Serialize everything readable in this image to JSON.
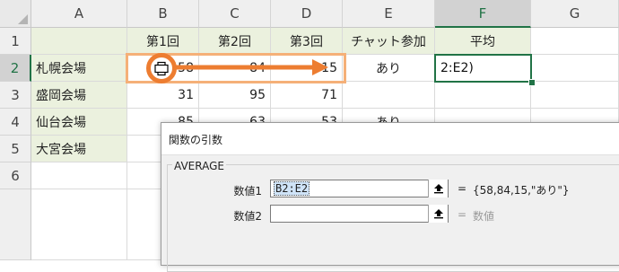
{
  "columns": [
    "A",
    "B",
    "C",
    "D",
    "E",
    "F",
    "G"
  ],
  "rows": [
    "1",
    "2",
    "3",
    "4",
    "5",
    "6"
  ],
  "header_row": {
    "b": "第1回",
    "c": "第2回",
    "d": "第3回",
    "e": "チャット参加",
    "f": "平均"
  },
  "data_rows": [
    {
      "a": "札幌会場",
      "b": "58",
      "c": "84",
      "d": "15",
      "e": "あり",
      "f": "2:E2)"
    },
    {
      "a": "盛岡会場",
      "b": "31",
      "c": "95",
      "d": "71",
      "e": "",
      "f": ""
    },
    {
      "a": "仙台会場",
      "b": "85",
      "c": "63",
      "d": "53",
      "e": "あり",
      "f": ""
    },
    {
      "a": "大宮会場",
      "b": "",
      "c": "",
      "d": "",
      "e": "",
      "f": ""
    }
  ],
  "colors": {
    "accent": "#217346",
    "highlight": "#f5b078",
    "arrow": "#ed7d31",
    "label_fill": "#ebf1de"
  },
  "icons": {
    "cursor": "plus-cross-cursor-icon",
    "collapse": "collapse-dialog-icon"
  },
  "dialog": {
    "title": "関数の引数",
    "function_name": "AVERAGE",
    "args": [
      {
        "label": "数値1",
        "value": "B2:E2",
        "result": "{58,84,15,\"あり\"}"
      },
      {
        "label": "数値2",
        "value": "",
        "result": "数値"
      }
    ],
    "equals": "="
  }
}
